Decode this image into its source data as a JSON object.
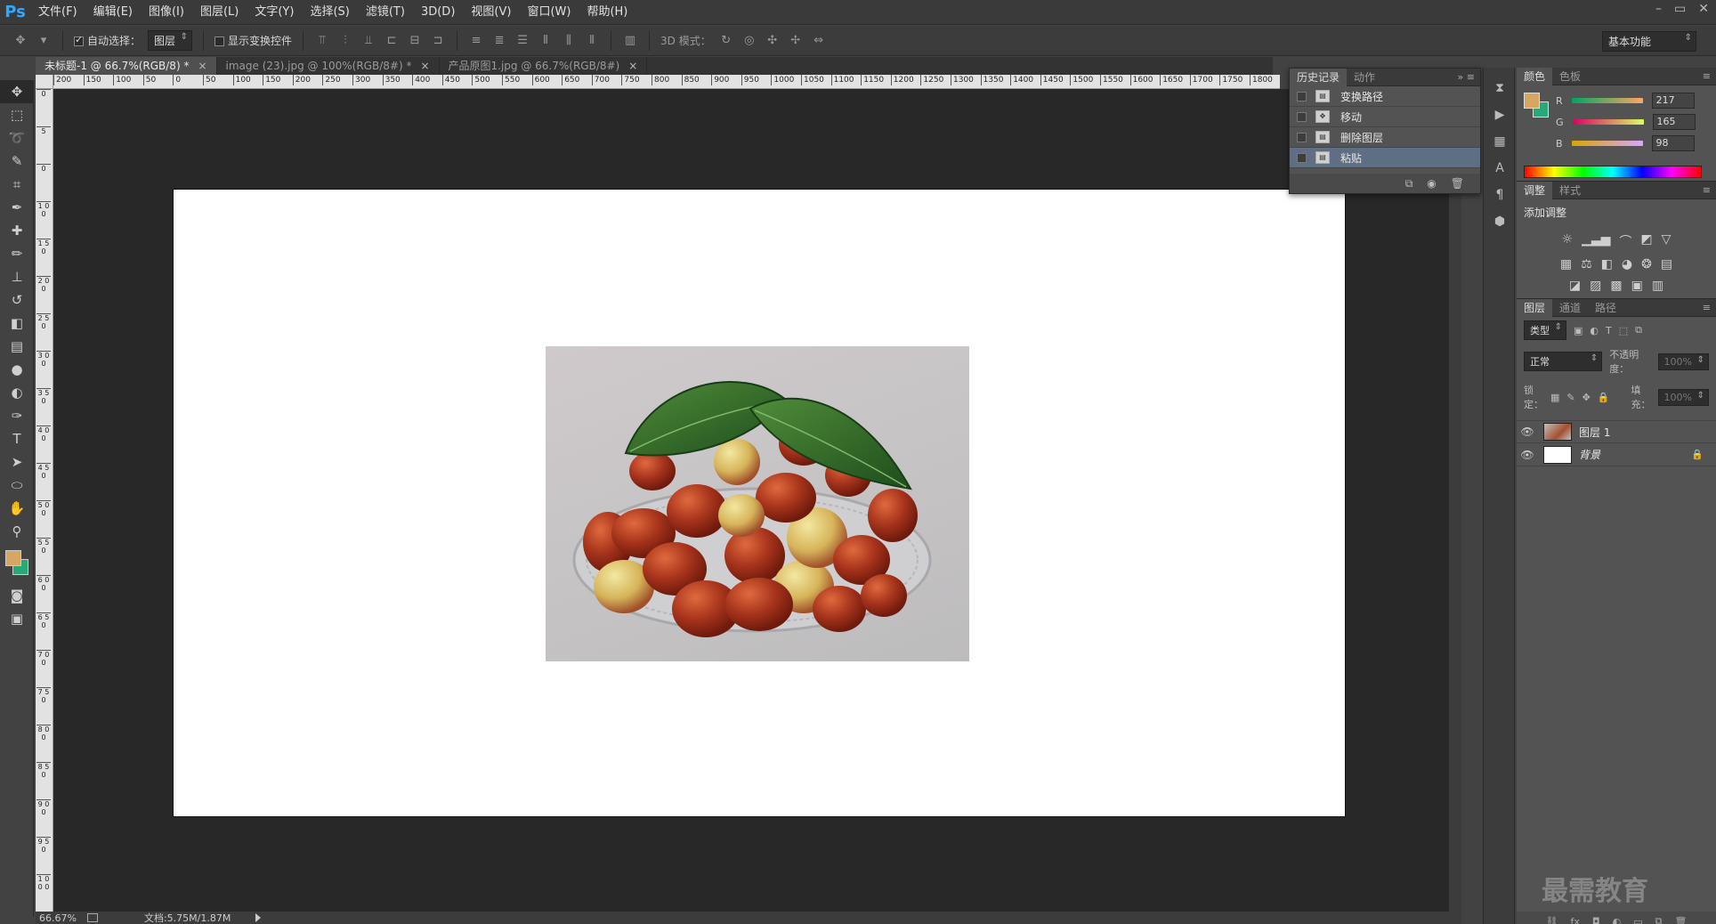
{
  "app": {
    "logo": "Ps"
  },
  "menu": [
    "文件(F)",
    "编辑(E)",
    "图像(I)",
    "图层(L)",
    "文字(Y)",
    "选择(S)",
    "滤镜(T)",
    "3D(D)",
    "视图(V)",
    "窗口(W)",
    "帮助(H)"
  ],
  "window_controls": [
    "–",
    "▭",
    "✕"
  ],
  "options": {
    "auto_select_label": "自动选择：",
    "auto_select_checked": true,
    "auto_select_target": "图层",
    "show_transform_label": "显示变换控件",
    "mode3d_label": "3D 模式：",
    "workspace": "基本功能"
  },
  "tabs": [
    {
      "label": "未标题-1 @ 66.7%(RGB/8) *",
      "active": true
    },
    {
      "label": "image (23).jpg @ 100%(RGB/8#) *",
      "active": false
    },
    {
      "label": "产品原图1.jpg @ 66.7%(RGB/8#)",
      "active": false
    }
  ],
  "tab_close": "×",
  "ruler_h": [
    "200",
    "150",
    "100",
    "50",
    "0",
    "50",
    "100",
    "150",
    "200",
    "250",
    "300",
    "350",
    "400",
    "450",
    "500",
    "550",
    "600",
    "650",
    "700",
    "750",
    "800",
    "850",
    "900",
    "950",
    "1000",
    "1050",
    "1100",
    "1150",
    "1200",
    "1250",
    "1300",
    "1350",
    "1400",
    "1450",
    "1500",
    "1550",
    "1600",
    "1650",
    "1700",
    "1750",
    "1800"
  ],
  "ruler_v": [
    "0",
    "5",
    "0",
    "1 0 0",
    "1 5 0",
    "2 0 0",
    "2 5 0",
    "3 0 0",
    "3 5 0",
    "4 0 0",
    "4 5 0",
    "5 0 0",
    "5 5 0",
    "6 0 0",
    "6 5 0",
    "7 0 0",
    "7 5 0",
    "8 0 0",
    "8 5 0",
    "9 0 0",
    "9 5 0",
    "1 0 0 0",
    "1 0 5 0"
  ],
  "status": {
    "zoom": "66.67%",
    "doc": "文档:5.75M/1.87M"
  },
  "history": {
    "tabs": [
      "历史记录",
      "动作"
    ],
    "items": [
      {
        "label": "变换路径",
        "selected": false
      },
      {
        "label": "移动",
        "selected": false
      },
      {
        "label": "删除图层",
        "selected": false
      },
      {
        "label": "粘贴",
        "selected": true
      }
    ]
  },
  "color_panel": {
    "tabs": [
      "颜色",
      "色板"
    ],
    "r_label": "R",
    "g_label": "G",
    "b_label": "B",
    "r": "217",
    "g": "165",
    "b": "98",
    "fg": "#d9a562",
    "bg": "#2aa87a"
  },
  "adjust_panel": {
    "tabs": [
      "调整",
      "样式"
    ],
    "title": "添加调整"
  },
  "layers_panel": {
    "tabs": [
      "图层",
      "通道",
      "路径"
    ],
    "filter": "类型",
    "blend": "正常",
    "opacity_label": "不透明度：",
    "opacity": "100%",
    "lock_label": "锁定：",
    "fill_label": "填充：",
    "fill": "100%",
    "layers": [
      {
        "name": "图层 1",
        "visible": true,
        "locked": false
      },
      {
        "name": "背景",
        "visible": true,
        "locked": true
      }
    ]
  },
  "watermark": "最需教育"
}
